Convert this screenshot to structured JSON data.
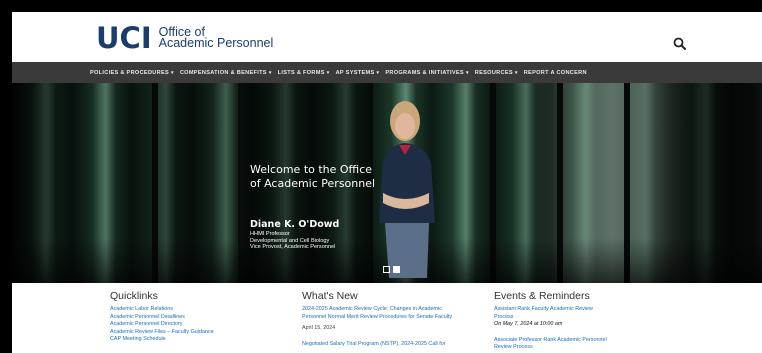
{
  "header": {
    "logo_mark": "UCI",
    "logo_line1": "Office of",
    "logo_line2": "Academic Personnel"
  },
  "nav": {
    "items": [
      {
        "label": "POLICIES & PROCEDURES",
        "dropdown": true
      },
      {
        "label": "COMPENSATION & BENEFITS",
        "dropdown": true
      },
      {
        "label": "LISTS & FORMS",
        "dropdown": true
      },
      {
        "label": "AP SYSTEMS",
        "dropdown": true
      },
      {
        "label": "PROGRAMS & INITIATIVES",
        "dropdown": true
      },
      {
        "label": "RESOURCES",
        "dropdown": true
      },
      {
        "label": "REPORT A CONCERN",
        "dropdown": false
      }
    ]
  },
  "hero": {
    "welcome_line1": "Welcome to the Office",
    "welcome_line2": "of Academic Personnel",
    "name": "Diane K. O'Dowd",
    "title1": "HHMI Professor",
    "title2": "Developmental and Cell Biology",
    "title3": "Vice Provost, Academic Personnel"
  },
  "quicklinks": {
    "heading": "Quicklinks",
    "links": [
      "Academic Labor Relations",
      "Academic Personnel Deadlines",
      "Academic Personnel Directory",
      "Academic Review Files – Faculty Guidance",
      "CAP Meeting Schedule"
    ]
  },
  "whats_new": {
    "heading": "What's New",
    "item1_line1": "2024-2025 Academic Review Cycle: Changes in Academic",
    "item1_line2": "Personnel Normal Merit Review Procedures for Senate Faculty",
    "item1_date": "April 15, 2024",
    "item2_line1": "Negotiated Salary Trial Program (NSTP), 2024-2025 Call for"
  },
  "events": {
    "heading": "Events & Reminders",
    "event1_line1": "Assistant Rank Faculty Academic Review",
    "event1_line2": "Process",
    "event1_when": "On May 7, 2024 at 10:00 am",
    "event2_line1": "Associate Professor Rank Academic Personnel",
    "event2_line2": "Review Process"
  },
  "colors": {
    "brand": "#1b3d6d",
    "nav_bg": "#3a3a3a",
    "link": "#1c6dbf"
  }
}
